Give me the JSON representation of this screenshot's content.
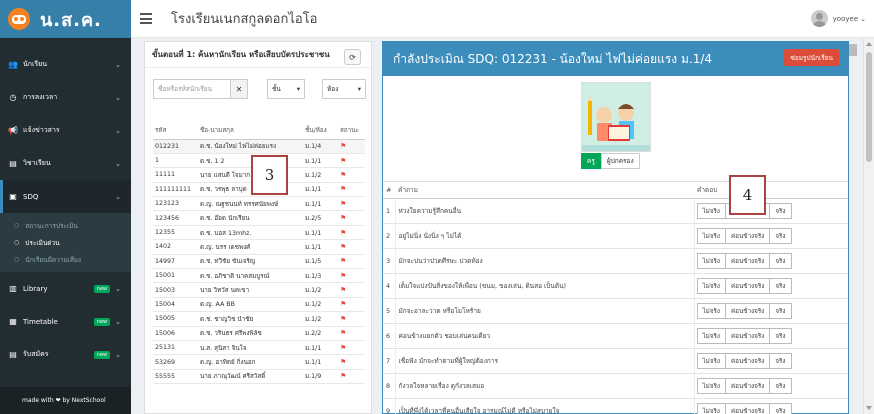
{
  "brand": {
    "name": "น.ส.ค."
  },
  "topbar": {
    "school": "โรงเรียนเนกสกูลดอกไอโอ",
    "user": "yooyee"
  },
  "sidebar": {
    "items": [
      {
        "label": "นักเรียน",
        "icon": "users-icon"
      },
      {
        "label": "การลงเวลา",
        "icon": "clock-icon"
      },
      {
        "label": "แจ้งข่าวสาร",
        "icon": "megaphone-icon"
      },
      {
        "label": "วิชาเรียน",
        "icon": "book-icon"
      },
      {
        "label": "SDQ",
        "icon": "clipboard-icon"
      }
    ],
    "sub": [
      {
        "label": "สถานะการประเมิน"
      },
      {
        "label": "ประเมินด่วน"
      },
      {
        "label": "นักเรียนมีความเสี่ยง"
      }
    ],
    "extra": [
      {
        "label": "Library",
        "badge": "new",
        "icon": "library-icon"
      },
      {
        "label": "Timetable",
        "badge": "new",
        "icon": "table-icon"
      },
      {
        "label": "รับสมัคร",
        "badge": "new",
        "icon": "form-icon"
      }
    ],
    "footer": "made with ❤ by NextSchool"
  },
  "left_panel": {
    "title": "ขั้นตอนที่ 1: ค้นหานักเรียน หรือเสียบบัตรประชาชน",
    "search_placeholder": "ชื่อหรือรหัสนักเรียน",
    "grade_select": "ชั้น",
    "room_select": "ห้อง",
    "columns": [
      "รหัส",
      "ชื่อ-นามสกุล",
      "ชั้น/ห้อง",
      "สถานะ"
    ],
    "rows": [
      [
        "012231",
        "ด.ช. น้องใหม่ ไฟไม่ค่อยแรง",
        "ม.1/4"
      ],
      [
        "1",
        "ด.ช. 1 2",
        "ม.1/1"
      ],
      [
        "11111",
        "นาย แสนดี ใจมาก",
        "ม.1/2"
      ],
      [
        "111111111",
        "ด.ช. วรพุธ ลาบุด",
        "ม.1/1"
      ],
      [
        "123123",
        "ด.ญ. ณฐชนนท์ ทรรศนัยพงษ์",
        "ม.1/1"
      ],
      [
        "123456",
        "ด.ช. อ๊อด นักเรียน",
        "ม.2/5"
      ],
      [
        "12355",
        "ด.ช. บอส 13mhz.",
        "ม.1/1"
      ],
      [
        "1402",
        "ด.ญ. นรร เดชพงศ์",
        "ม.1/1"
      ],
      [
        "14997",
        "ด.ช. ทวีชัย ขันเจริญ",
        "ม.1/5"
      ],
      [
        "15001",
        "ด.ช. อภิชาติ นาคสมบูรณ์",
        "ม.1/3"
      ],
      [
        "15003",
        "นาย วิทวัส นคเขา",
        "ม.1/2"
      ],
      [
        "15004",
        "ด.ญ. AA BB",
        "ม.1/2"
      ],
      [
        "15005",
        "ด.ช. ชาญวิช นำชัย",
        "ม.1/2"
      ],
      [
        "15006",
        "ด.ช. วรินธร ศรีพงพิลัช",
        "ม.2/2"
      ],
      [
        "25131",
        "น.ส. สุนิสา จินใจ",
        "ม.1/1"
      ],
      [
        "53269",
        "ด.ญ. อาทิตย์ กิ่งนอก",
        "ม.1/1"
      ],
      [
        "55555",
        "นาย ภาณุวัฒน์ ศรีสวัสดิ์",
        "ม.1/9"
      ]
    ]
  },
  "right_panel": {
    "title": "กำลังประเมิณ SDQ: 012231 - น้องใหม่ ไฟไม่ค่อยแรง ม.1/4",
    "repair_button": "ซ่อมรูปนักเรียน",
    "role_tabs": [
      "ครู",
      "ผู้ปกครอง"
    ],
    "columns": [
      "#",
      "คำถาม",
      "คำตอบ"
    ],
    "answers": [
      "ไม่จริง",
      "ค่อนข้างจริง",
      "จริง"
    ],
    "questions": [
      "ห่วงใยความรู้สึกคนอื่น",
      "อยู่ไม่นิ่ง นั่งนิ่ง ๆ ไม่ได้",
      "มักจะบ่นว่าปวดศีรษะ ปวดท้อง",
      "เต็มใจแบ่งปันสิ่งของให้เพื่อน (ขนม, ของเล่น, ดินสอ เป็นต้น)",
      "มักจะอาละวาด หรือโมโหร้าย",
      "ค่อนข้างแยกตัว ชอบเล่นคนเดียว",
      "เชื่อฟัง มักจะทำตามที่ผู้ใหญ่ต้องการ",
      "กังวลใจหลายเรื่อง ดูกังวลเสมอ",
      "เป็นที่พึ่งได้เวลาที่คนอื่นเสียใจ อารมณ์ไม่ดี หรือไม่สบายใจ"
    ]
  },
  "markers": [
    "3",
    "4"
  ]
}
